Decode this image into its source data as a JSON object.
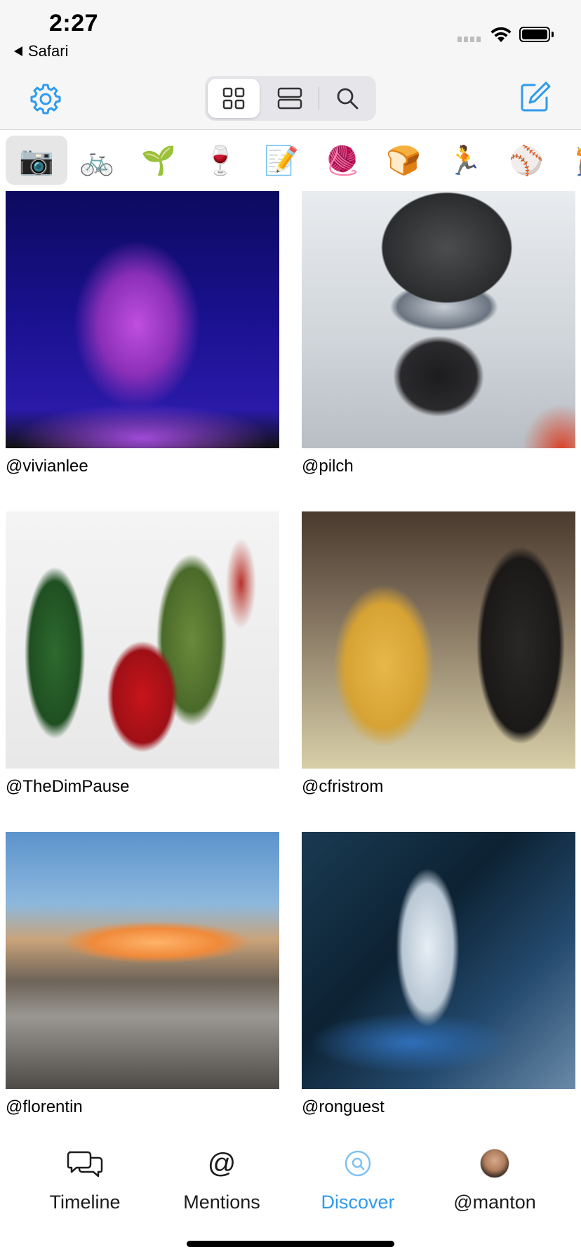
{
  "status_bar": {
    "time": "2:27",
    "back_app": "Safari"
  },
  "toolbar": {
    "settings_icon": "gear-icon",
    "view_modes": [
      {
        "icon": "grid-view-icon",
        "selected": true
      },
      {
        "icon": "list-view-icon",
        "selected": false
      },
      {
        "icon": "search-icon",
        "selected": false
      }
    ],
    "compose_icon": "compose-icon",
    "accent_color": "#2f9bec"
  },
  "filters": [
    {
      "emoji": "📷",
      "selected": true
    },
    {
      "emoji": "🚲",
      "selected": false
    },
    {
      "emoji": "🌱",
      "selected": false
    },
    {
      "emoji": "🍷",
      "selected": false
    },
    {
      "emoji": "📝",
      "selected": false
    },
    {
      "emoji": "🧶",
      "selected": false
    },
    {
      "emoji": "🍞",
      "selected": false
    },
    {
      "emoji": "🏃",
      "selected": false
    },
    {
      "emoji": "⚾",
      "selected": false
    },
    {
      "emoji": "🏌",
      "selected": false
    }
  ],
  "photos": [
    {
      "username": "@vivianlee"
    },
    {
      "username": "@pilch"
    },
    {
      "username": "@TheDimPause"
    },
    {
      "username": "@cfristrom"
    },
    {
      "username": "@florentin"
    },
    {
      "username": "@ronguest"
    }
  ],
  "tab_bar": {
    "tabs": [
      {
        "label": "Timeline",
        "icon": "chat-bubbles-icon",
        "active": false
      },
      {
        "label": "Mentions",
        "icon": "at-icon",
        "glyph": "@",
        "active": false
      },
      {
        "label": "Discover",
        "icon": "discover-search-icon",
        "active": true
      },
      {
        "label": "@manton",
        "icon": "avatar",
        "active": false
      }
    ]
  }
}
